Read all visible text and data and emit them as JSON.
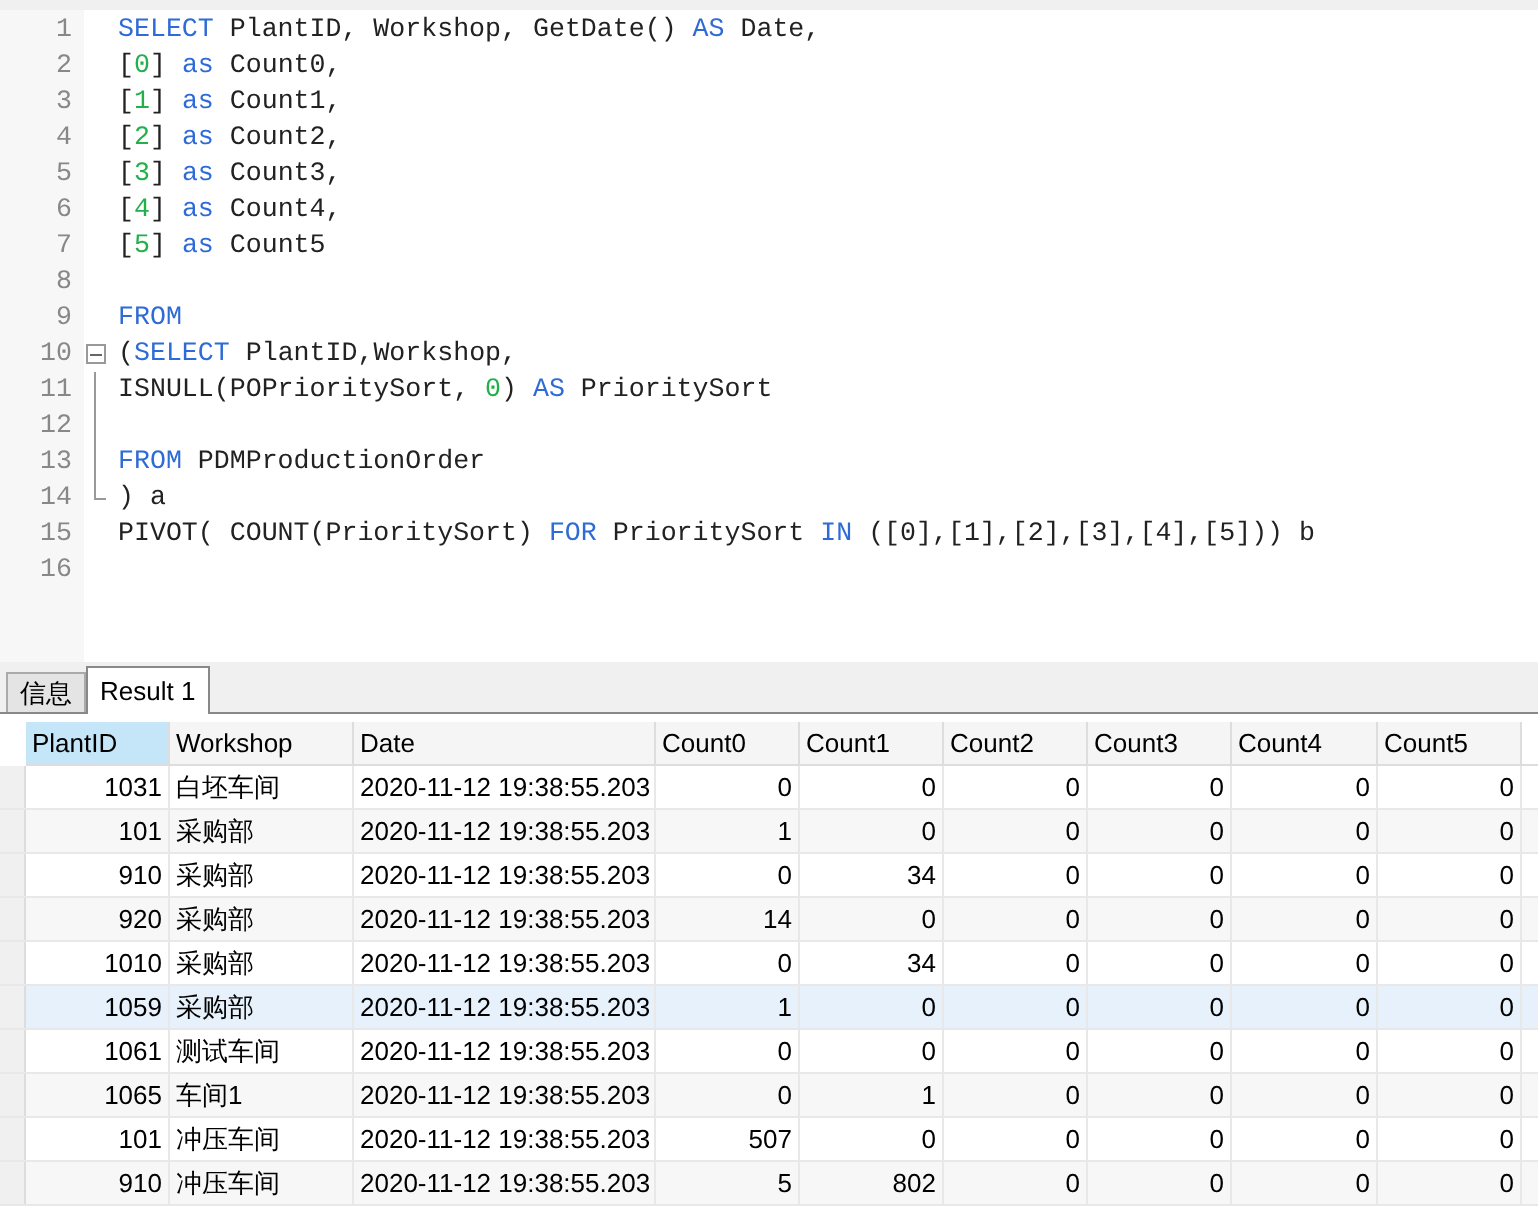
{
  "editor": {
    "lines": [
      {
        "number": "1",
        "tokens": [
          {
            "kind": "kw",
            "text": "SELECT"
          },
          {
            "kind": "plain",
            "text": " PlantID, Workshop, GetDate() "
          },
          {
            "kind": "kw",
            "text": "AS"
          },
          {
            "kind": "plain",
            "text": " Date,"
          }
        ]
      },
      {
        "number": "2",
        "tokens": [
          {
            "kind": "plain",
            "text": "["
          },
          {
            "kind": "num",
            "text": "0"
          },
          {
            "kind": "plain",
            "text": "] "
          },
          {
            "kind": "kw",
            "text": "as"
          },
          {
            "kind": "plain",
            "text": " Count0,"
          }
        ]
      },
      {
        "number": "3",
        "tokens": [
          {
            "kind": "plain",
            "text": "["
          },
          {
            "kind": "num",
            "text": "1"
          },
          {
            "kind": "plain",
            "text": "] "
          },
          {
            "kind": "kw",
            "text": "as"
          },
          {
            "kind": "plain",
            "text": " Count1,"
          }
        ]
      },
      {
        "number": "4",
        "tokens": [
          {
            "kind": "plain",
            "text": "["
          },
          {
            "kind": "num",
            "text": "2"
          },
          {
            "kind": "plain",
            "text": "] "
          },
          {
            "kind": "kw",
            "text": "as"
          },
          {
            "kind": "plain",
            "text": " Count2,"
          }
        ]
      },
      {
        "number": "5",
        "tokens": [
          {
            "kind": "plain",
            "text": "["
          },
          {
            "kind": "num",
            "text": "3"
          },
          {
            "kind": "plain",
            "text": "] "
          },
          {
            "kind": "kw",
            "text": "as"
          },
          {
            "kind": "plain",
            "text": " Count3,"
          }
        ]
      },
      {
        "number": "6",
        "tokens": [
          {
            "kind": "plain",
            "text": "["
          },
          {
            "kind": "num",
            "text": "4"
          },
          {
            "kind": "plain",
            "text": "] "
          },
          {
            "kind": "kw",
            "text": "as"
          },
          {
            "kind": "plain",
            "text": " Count4,"
          }
        ]
      },
      {
        "number": "7",
        "tokens": [
          {
            "kind": "plain",
            "text": "["
          },
          {
            "kind": "num",
            "text": "5"
          },
          {
            "kind": "plain",
            "text": "] "
          },
          {
            "kind": "kw",
            "text": "as"
          },
          {
            "kind": "plain",
            "text": " Count5"
          }
        ]
      },
      {
        "number": "8"
      },
      {
        "number": "9",
        "tokens": [
          {
            "kind": "kw",
            "text": "FROM"
          }
        ]
      },
      {
        "number": "10",
        "kind": "foldstart",
        "tokens": [
          {
            "kind": "plain",
            "text": "("
          },
          {
            "kind": "kw",
            "text": "SELECT"
          },
          {
            "kind": "plain",
            "text": " PlantID,Workshop,"
          }
        ]
      },
      {
        "number": "11",
        "kind": "foldinner",
        "tokens": [
          {
            "kind": "plain",
            "text": "ISNULL(POPrioritySort, "
          },
          {
            "kind": "num",
            "text": "0"
          },
          {
            "kind": "plain",
            "text": ") "
          },
          {
            "kind": "kw",
            "text": "AS"
          },
          {
            "kind": "plain",
            "text": " PrioritySort"
          }
        ]
      },
      {
        "number": "12",
        "kind": "foldinner"
      },
      {
        "number": "13",
        "kind": "foldinner",
        "tokens": [
          {
            "kind": "kw",
            "text": "FROM"
          },
          {
            "kind": "plain",
            "text": " PDMProductionOrder"
          }
        ]
      },
      {
        "number": "14",
        "kind": "foldend",
        "tokens": [
          {
            "kind": "plain",
            "text": ") a"
          }
        ]
      },
      {
        "number": "15",
        "tokens": [
          {
            "kind": "plain",
            "text": "PIVOT( COUNT(PrioritySort) "
          },
          {
            "kind": "kw",
            "text": "FOR"
          },
          {
            "kind": "plain",
            "text": " PrioritySort "
          },
          {
            "kind": "kw",
            "text": "IN"
          },
          {
            "kind": "plain",
            "text": " ([0],[1],[2],[3],[4],[5])) b"
          }
        ]
      },
      {
        "number": "16"
      }
    ]
  },
  "tabs": [
    {
      "label": "信息",
      "selected": false
    },
    {
      "label": "Result 1",
      "selected": true
    }
  ],
  "table": {
    "columns": [
      {
        "label": "PlantID",
        "selected": true
      },
      {
        "label": "Workshop",
        "selected": false
      },
      {
        "label": "Date",
        "selected": false
      },
      {
        "label": "Count0",
        "selected": false
      },
      {
        "label": "Count1",
        "selected": false
      },
      {
        "label": "Count2",
        "selected": false
      },
      {
        "label": "Count3",
        "selected": false
      },
      {
        "label": "Count4",
        "selected": false
      },
      {
        "label": "Count5",
        "selected": false
      }
    ],
    "rows": [
      {
        "selected": false,
        "cells": [
          "1031",
          "白坯车间",
          "2020-11-12 19:38:55.203",
          "0",
          "0",
          "0",
          "0",
          "0",
          "0"
        ]
      },
      {
        "selected": false,
        "cells": [
          "101",
          "采购部",
          "2020-11-12 19:38:55.203",
          "1",
          "0",
          "0",
          "0",
          "0",
          "0"
        ]
      },
      {
        "selected": false,
        "cells": [
          "910",
          "采购部",
          "2020-11-12 19:38:55.203",
          "0",
          "34",
          "0",
          "0",
          "0",
          "0"
        ]
      },
      {
        "selected": false,
        "cells": [
          "920",
          "采购部",
          "2020-11-12 19:38:55.203",
          "14",
          "0",
          "0",
          "0",
          "0",
          "0"
        ]
      },
      {
        "selected": false,
        "cells": [
          "1010",
          "采购部",
          "2020-11-12 19:38:55.203",
          "0",
          "34",
          "0",
          "0",
          "0",
          "0"
        ]
      },
      {
        "selected": true,
        "cells": [
          "1059",
          "采购部",
          "2020-11-12 19:38:55.203",
          "1",
          "0",
          "0",
          "0",
          "0",
          "0"
        ]
      },
      {
        "selected": false,
        "cells": [
          "1061",
          "测试车间",
          "2020-11-12 19:38:55.203",
          "0",
          "0",
          "0",
          "0",
          "0",
          "0"
        ]
      },
      {
        "selected": false,
        "cells": [
          "1065",
          "车间1",
          "2020-11-12 19:38:55.203",
          "0",
          "1",
          "0",
          "0",
          "0",
          "0"
        ]
      },
      {
        "selected": false,
        "cells": [
          "101",
          "冲压车间",
          "2020-11-12 19:38:55.203",
          "507",
          "0",
          "0",
          "0",
          "0",
          "0"
        ]
      },
      {
        "selected": false,
        "cells": [
          "910",
          "冲压车间",
          "2020-11-12 19:38:55.203",
          "5",
          "802",
          "0",
          "0",
          "0",
          "0"
        ]
      }
    ]
  }
}
